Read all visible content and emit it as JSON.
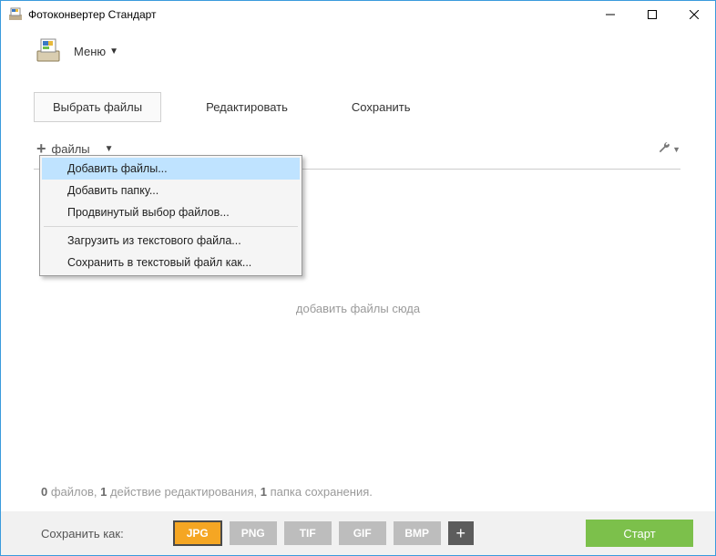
{
  "window": {
    "title": "Фотоконвертер Стандарт"
  },
  "menu": {
    "label": "Меню"
  },
  "tabs": {
    "select": "Выбрать файлы",
    "edit": "Редактировать",
    "save": "Сохранить"
  },
  "toolbar": {
    "files_label": "файлы",
    "plus": "+"
  },
  "dropdown": {
    "add_files": "Добавить файлы...",
    "add_folder": "Добавить папку...",
    "advanced_select": "Продвинутый выбор файлов...",
    "load_txt": "Загрузить из текстового файла...",
    "save_txt": "Сохранить в текстовый файл как..."
  },
  "drop_hint": "добавить файлы сюда",
  "status": {
    "files_n": "0",
    "files_w": " файлов, ",
    "edits_n": "1",
    "edits_w": " действие редактирования, ",
    "folders_n": "1",
    "folders_w": " папка сохранения."
  },
  "bottom": {
    "save_as": "Сохранить как:",
    "formats": {
      "jpg": "JPG",
      "png": "PNG",
      "tif": "TIF",
      "gif": "GIF",
      "bmp": "BMP",
      "add": "+"
    },
    "start": "Старт"
  }
}
